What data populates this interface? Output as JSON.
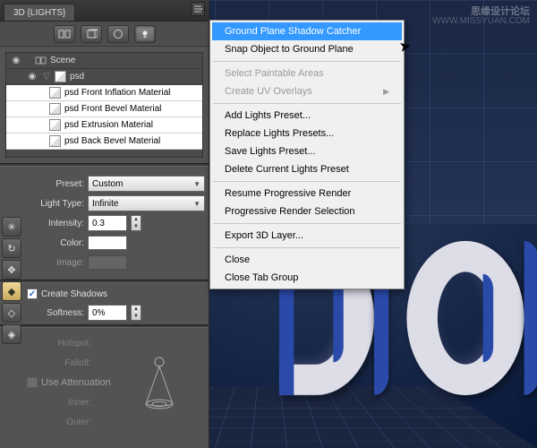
{
  "watermark": {
    "line1": "思缘设计论坛",
    "line2": "WWW.MISSYUAN.COM"
  },
  "panel": {
    "tab": "3D {LIGHTS}",
    "scene_label": "Scene",
    "psd_label": "psd",
    "materials": [
      "psd Front Inflation Material",
      "psd Front Bevel Material",
      "psd Extrusion Material",
      "psd Back Bevel Material"
    ],
    "preset_label": "Preset:",
    "preset_value": "Custom",
    "light_type_label": "Light Type:",
    "light_type_value": "Infinite",
    "intensity_label": "Intensity:",
    "intensity_value": "0.3",
    "color_label": "Color:",
    "image_label": "Image:",
    "create_shadows": "Create Shadows",
    "softness_label": "Softness:",
    "softness_value": "0%",
    "hotspot_label": "Hotspot:",
    "falloff_label": "Falloff:",
    "use_atten": "Use Attenuation",
    "inner_label": "Inner:",
    "outer_label": "Outer:"
  },
  "menu": {
    "items": [
      {
        "label": "Ground Plane Shadow Catcher",
        "hl": true
      },
      {
        "label": "Snap Object to Ground Plane"
      },
      {
        "sep": true
      },
      {
        "label": "Select Paintable Areas",
        "dis": true
      },
      {
        "label": "Create UV Overlays",
        "dis": true,
        "sub": true
      },
      {
        "sep": true
      },
      {
        "label": "Add Lights Preset..."
      },
      {
        "label": "Replace Lights Presets..."
      },
      {
        "label": "Save Lights Preset..."
      },
      {
        "label": "Delete Current Lights Preset"
      },
      {
        "sep": true
      },
      {
        "label": "Resume Progressive Render"
      },
      {
        "label": "Progressive Render Selection"
      },
      {
        "sep": true
      },
      {
        "label": "Export 3D Layer..."
      },
      {
        "sep": true
      },
      {
        "label": "Close"
      },
      {
        "label": "Close Tab Group"
      }
    ]
  }
}
